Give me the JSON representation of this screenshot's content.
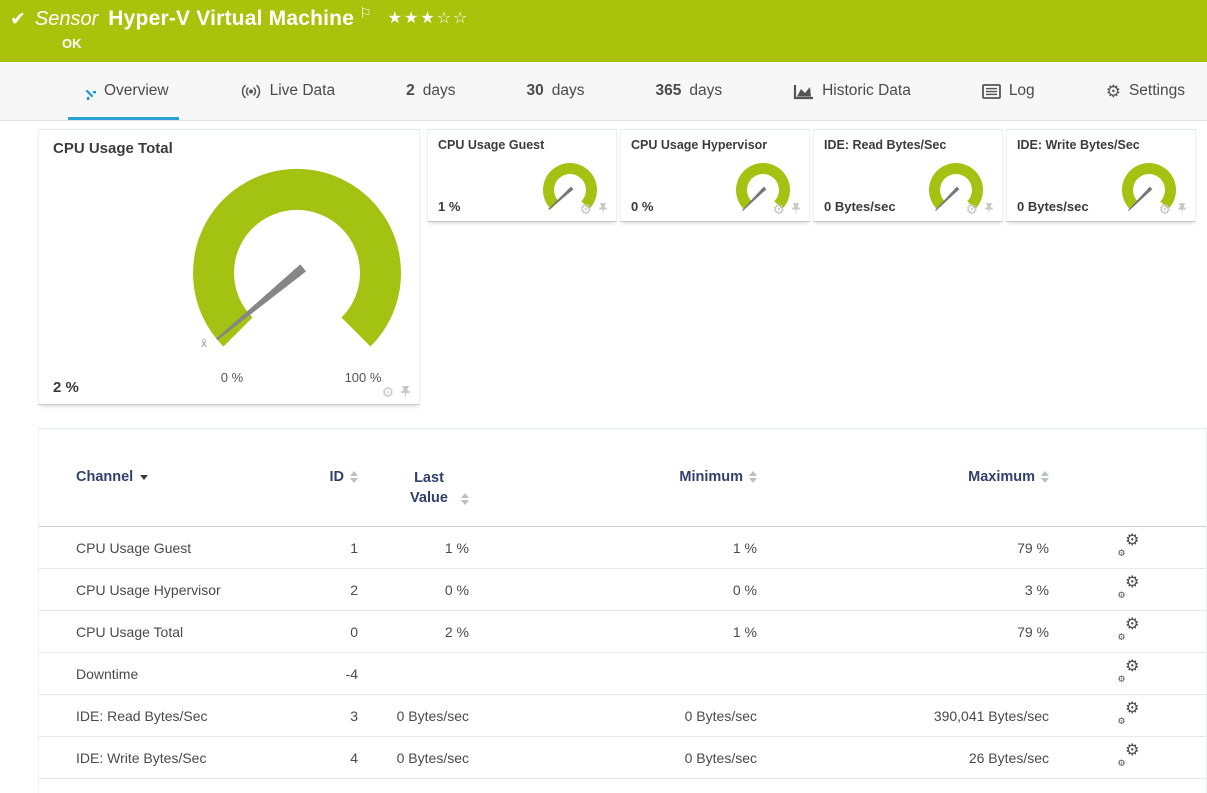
{
  "colors": {
    "green": "#a9c30d",
    "gauge": "#a4c212",
    "blue": "#2a9fd8",
    "navy": "#32406d",
    "text": "#4a4a4a",
    "lightgear": "#c6c6c6"
  },
  "banner": {
    "kind_label": "Sensor",
    "title": "Hyper-V Virtual Machine",
    "status": "OK",
    "check_icon": "✔",
    "flag_icon": "⚐",
    "stars": "★★★☆☆",
    "rating_filled": 3,
    "rating_total": 5
  },
  "tabs": [
    {
      "label": "Overview",
      "active": true
    },
    {
      "label": "Live Data"
    },
    {
      "num": "2",
      "label": "days"
    },
    {
      "num": "30",
      "label": "days"
    },
    {
      "num": "365",
      "label": "days"
    },
    {
      "label": "Historic Data"
    },
    {
      "label": "Log"
    },
    {
      "label": "Settings"
    }
  ],
  "gauges": {
    "main": {
      "title": "CPU Usage Total",
      "value": "2 %",
      "percent": 2,
      "min_label": "0 %",
      "max_label": "100 %",
      "avg_marker": "x̄"
    },
    "small": [
      {
        "title": "CPU Usage Guest",
        "value": "1 %",
        "percent": 1
      },
      {
        "title": "CPU Usage Hypervisor",
        "value": "0 %",
        "percent": 0
      },
      {
        "title": "IDE: Read Bytes/Sec",
        "value": "0 Bytes/sec",
        "percent": 0
      },
      {
        "title": "IDE: Write Bytes/Sec",
        "value": "0 Bytes/sec",
        "percent": 0
      }
    ]
  },
  "icons": {
    "gear": "⚙"
  },
  "table": {
    "headers": {
      "channel": "Channel",
      "id": "ID",
      "last": "Last Value",
      "min": "Minimum",
      "max": "Maximum"
    },
    "rows": [
      {
        "channel": "CPU Usage Guest",
        "id": "1",
        "last": "1 %",
        "min": "1 %",
        "max": "79 %"
      },
      {
        "channel": "CPU Usage Hypervisor",
        "id": "2",
        "last": "0 %",
        "min": "0 %",
        "max": "3 %"
      },
      {
        "channel": "CPU Usage Total",
        "id": "0",
        "last": "2 %",
        "min": "1 %",
        "max": "79 %"
      },
      {
        "channel": "Downtime",
        "id": "-4",
        "last": "",
        "min": "",
        "max": ""
      },
      {
        "channel": "IDE: Read Bytes/Sec",
        "id": "3",
        "last": "0 Bytes/sec",
        "min": "0 Bytes/sec",
        "max": "390,041 Bytes/sec"
      },
      {
        "channel": "IDE: Write Bytes/Sec",
        "id": "4",
        "last": "0 Bytes/sec",
        "min": "0 Bytes/sec",
        "max": "26 Bytes/sec"
      }
    ]
  }
}
